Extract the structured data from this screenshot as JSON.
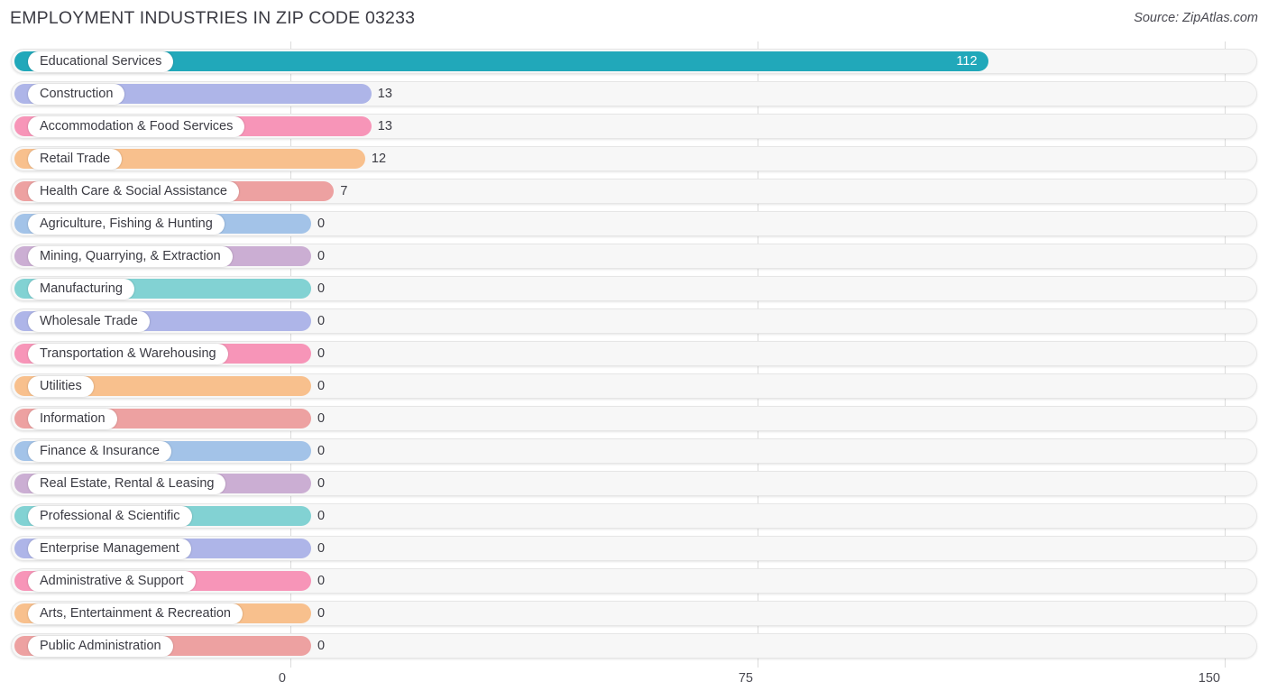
{
  "header": {
    "title": "EMPLOYMENT INDUSTRIES IN ZIP CODE 03233",
    "source": "Source: ZipAtlas.com"
  },
  "axis": {
    "ticks": [
      "0",
      "75",
      "150"
    ],
    "min": 0,
    "max": 150
  },
  "chart_data": {
    "type": "bar",
    "orientation": "horizontal",
    "title": "EMPLOYMENT INDUSTRIES IN ZIP CODE 03233",
    "subtitle": "Source: ZipAtlas.com",
    "xlabel": "",
    "ylabel": "",
    "xlim": [
      0,
      150
    ],
    "xticks": [
      0,
      75,
      150
    ],
    "grid": true,
    "legend": false,
    "categories": [
      "Educational Services",
      "Construction",
      "Accommodation & Food Services",
      "Retail Trade",
      "Health Care & Social Assistance",
      "Agriculture, Fishing & Hunting",
      "Mining, Quarrying, & Extraction",
      "Manufacturing",
      "Wholesale Trade",
      "Transportation & Warehousing",
      "Utilities",
      "Information",
      "Finance & Insurance",
      "Real Estate, Rental & Leasing",
      "Professional & Scientific",
      "Enterprise Management",
      "Administrative & Support",
      "Arts, Entertainment & Recreation",
      "Public Administration"
    ],
    "values": [
      112,
      13,
      13,
      12,
      7,
      0,
      0,
      0,
      0,
      0,
      0,
      0,
      0,
      0,
      0,
      0,
      0,
      0,
      0
    ],
    "value_labels": [
      "112",
      "13",
      "13",
      "12",
      "7",
      "0",
      "0",
      "0",
      "0",
      "0",
      "0",
      "0",
      "0",
      "0",
      "0",
      "0",
      "0",
      "0",
      "0"
    ],
    "colors": [
      "#21a8ba",
      "#aeb5e8",
      "#f795b8",
      "#f8c08d",
      "#eda1a1",
      "#a3c3e8",
      "#cbaed3",
      "#82d2d3",
      "#aeb5e8",
      "#f795b8",
      "#f8c08d",
      "#eda1a1",
      "#a3c3e8",
      "#cbaed3",
      "#82d2d3",
      "#aeb5e8",
      "#f795b8",
      "#f8c08d",
      "#eda1a1"
    ]
  },
  "rows": [
    {
      "label": "Educational Services",
      "value_label": "112",
      "value": 112,
      "color": "#21a8ba",
      "label_inside": true
    },
    {
      "label": "Construction",
      "value_label": "13",
      "value": 13,
      "color": "#aeb5e8",
      "label_inside": false
    },
    {
      "label": "Accommodation & Food Services",
      "value_label": "13",
      "value": 13,
      "color": "#f795b8",
      "label_inside": false
    },
    {
      "label": "Retail Trade",
      "value_label": "12",
      "value": 12,
      "color": "#f8c08d",
      "label_inside": false
    },
    {
      "label": "Health Care & Social Assistance",
      "value_label": "7",
      "value": 7,
      "color": "#eda1a1",
      "label_inside": false
    },
    {
      "label": "Agriculture, Fishing & Hunting",
      "value_label": "0",
      "value": 0,
      "color": "#a3c3e8",
      "label_inside": false
    },
    {
      "label": "Mining, Quarrying, & Extraction",
      "value_label": "0",
      "value": 0,
      "color": "#cbaed3",
      "label_inside": false
    },
    {
      "label": "Manufacturing",
      "value_label": "0",
      "value": 0,
      "color": "#82d2d3",
      "label_inside": false
    },
    {
      "label": "Wholesale Trade",
      "value_label": "0",
      "value": 0,
      "color": "#aeb5e8",
      "label_inside": false
    },
    {
      "label": "Transportation & Warehousing",
      "value_label": "0",
      "value": 0,
      "color": "#f795b8",
      "label_inside": false
    },
    {
      "label": "Utilities",
      "value_label": "0",
      "value": 0,
      "color": "#f8c08d",
      "label_inside": false
    },
    {
      "label": "Information",
      "value_label": "0",
      "value": 0,
      "color": "#eda1a1",
      "label_inside": false
    },
    {
      "label": "Finance & Insurance",
      "value_label": "0",
      "value": 0,
      "color": "#a3c3e8",
      "label_inside": false
    },
    {
      "label": "Real Estate, Rental & Leasing",
      "value_label": "0",
      "value": 0,
      "color": "#cbaed3",
      "label_inside": false
    },
    {
      "label": "Professional & Scientific",
      "value_label": "0",
      "value": 0,
      "color": "#82d2d3",
      "label_inside": false
    },
    {
      "label": "Enterprise Management",
      "value_label": "0",
      "value": 0,
      "color": "#aeb5e8",
      "label_inside": false
    },
    {
      "label": "Administrative & Support",
      "value_label": "0",
      "value": 0,
      "color": "#f795b8",
      "label_inside": false
    },
    {
      "label": "Arts, Entertainment & Recreation",
      "value_label": "0",
      "value": 0,
      "color": "#f8c08d",
      "label_inside": false
    },
    {
      "label": "Public Administration",
      "value_label": "0",
      "value": 0,
      "color": "#eda1a1",
      "label_inside": false
    }
  ]
}
